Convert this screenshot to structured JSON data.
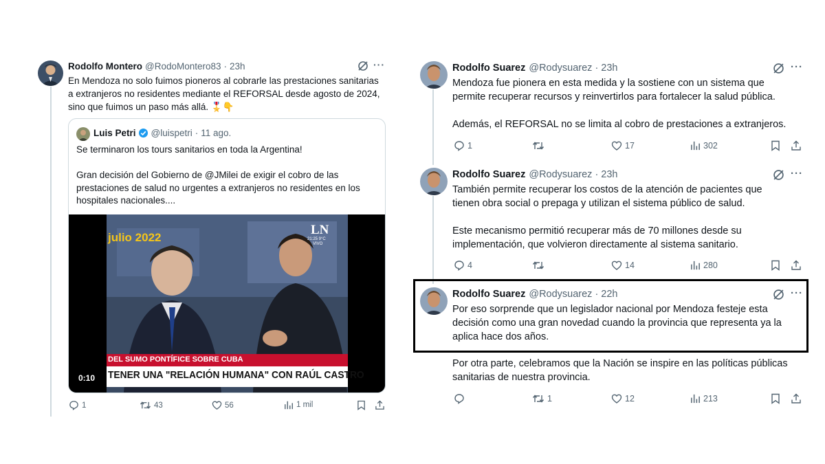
{
  "left_tweet": {
    "author": "Rodolfo Montero",
    "handle": "@RodoMontero83",
    "time": "23h",
    "text": "En Mendoza no solo fuimos pioneros al cobrarle las prestaciones sanitarias\na extranjeros no residentes mediante el REFORSAL desde agosto de 2024,\nsino que fuimos un paso más allá. 🎖️👇",
    "quote": {
      "author": "Luis Petri",
      "handle": "@luispetri",
      "date": "11 ago.",
      "text": "Se terminaron los tours sanitarios en toda la Argentina!\n\nGran decisión del Gobierno de @JMilei de exigir el cobro de las\nprestaciones de salud no urgentes a extranjeros no residentes en los\nhospitales nacionales....",
      "video": {
        "overlay_date": "julio 2022",
        "channel_logo": "LN",
        "channel_time": "21:25 9°C",
        "channel_live": "VIVO",
        "ticker_top": "DEL SUMO PONTÍFICE SOBRE CUBA",
        "ticker_main": "TENER UNA \"RELACIÓN HUMANA\" CON RAÚL CASTRO",
        "duration": "0:10"
      }
    },
    "actions": {
      "replies": "1",
      "retweets": "43",
      "likes": "56",
      "views": "1 mil"
    }
  },
  "right_tweets": [
    {
      "author": "Rodolfo Suarez",
      "handle": "@Rodysuarez",
      "time": "23h",
      "text": "Mendoza fue pionera en esta medida y la sostiene con un sistema que\npermite recuperar recursos y reinvertirlos para fortalecer la salud pública.\n\nAdemás, el REFORSAL no se limita al cobro de prestaciones a extranjeros.",
      "actions": {
        "replies": "1",
        "retweets": "",
        "likes": "17",
        "views": "302"
      }
    },
    {
      "author": "Rodolfo Suarez",
      "handle": "@Rodysuarez",
      "time": "23h",
      "text": "También permite recuperar los costos de la atención de pacientes que\ntienen obra social o prepaga y utilizan el sistema público de salud.\n\nEste mecanismo permitió recuperar más de 70 millones desde su\nimplementación, que volvieron directamente al sistema sanitario.",
      "actions": {
        "replies": "4",
        "retweets": "",
        "likes": "14",
        "views": "280"
      }
    },
    {
      "author": "Rodolfo Suarez",
      "handle": "@Rodysuarez",
      "time": "22h",
      "text_highlighted": "Por eso sorprende que un legislador nacional por Mendoza festeje esta\ndecisión como una gran novedad cuando la provincia que representa ya la\naplica hace dos años.",
      "text_rest": "Por otra parte, celebramos que la Nación se inspire en las políticas públicas\nsanitarias de nuestra provincia.",
      "actions": {
        "replies": "",
        "retweets": "1",
        "likes": "12",
        "views": "213"
      }
    }
  ],
  "icons": {
    "reply": "reply-icon",
    "retweet": "retweet-icon",
    "like": "like-icon",
    "views": "views-icon",
    "bookmark": "bookmark-icon",
    "share": "share-icon",
    "grok": "grok-icon",
    "more": "more-icon",
    "verified": "verified-badge-icon"
  },
  "colors": {
    "text": "#0f1419",
    "muted": "#536471",
    "border": "#cfd9de",
    "verified": "#1d9bf0",
    "ticker_red": "#c8102e",
    "overlay_date": "#f5c518"
  }
}
